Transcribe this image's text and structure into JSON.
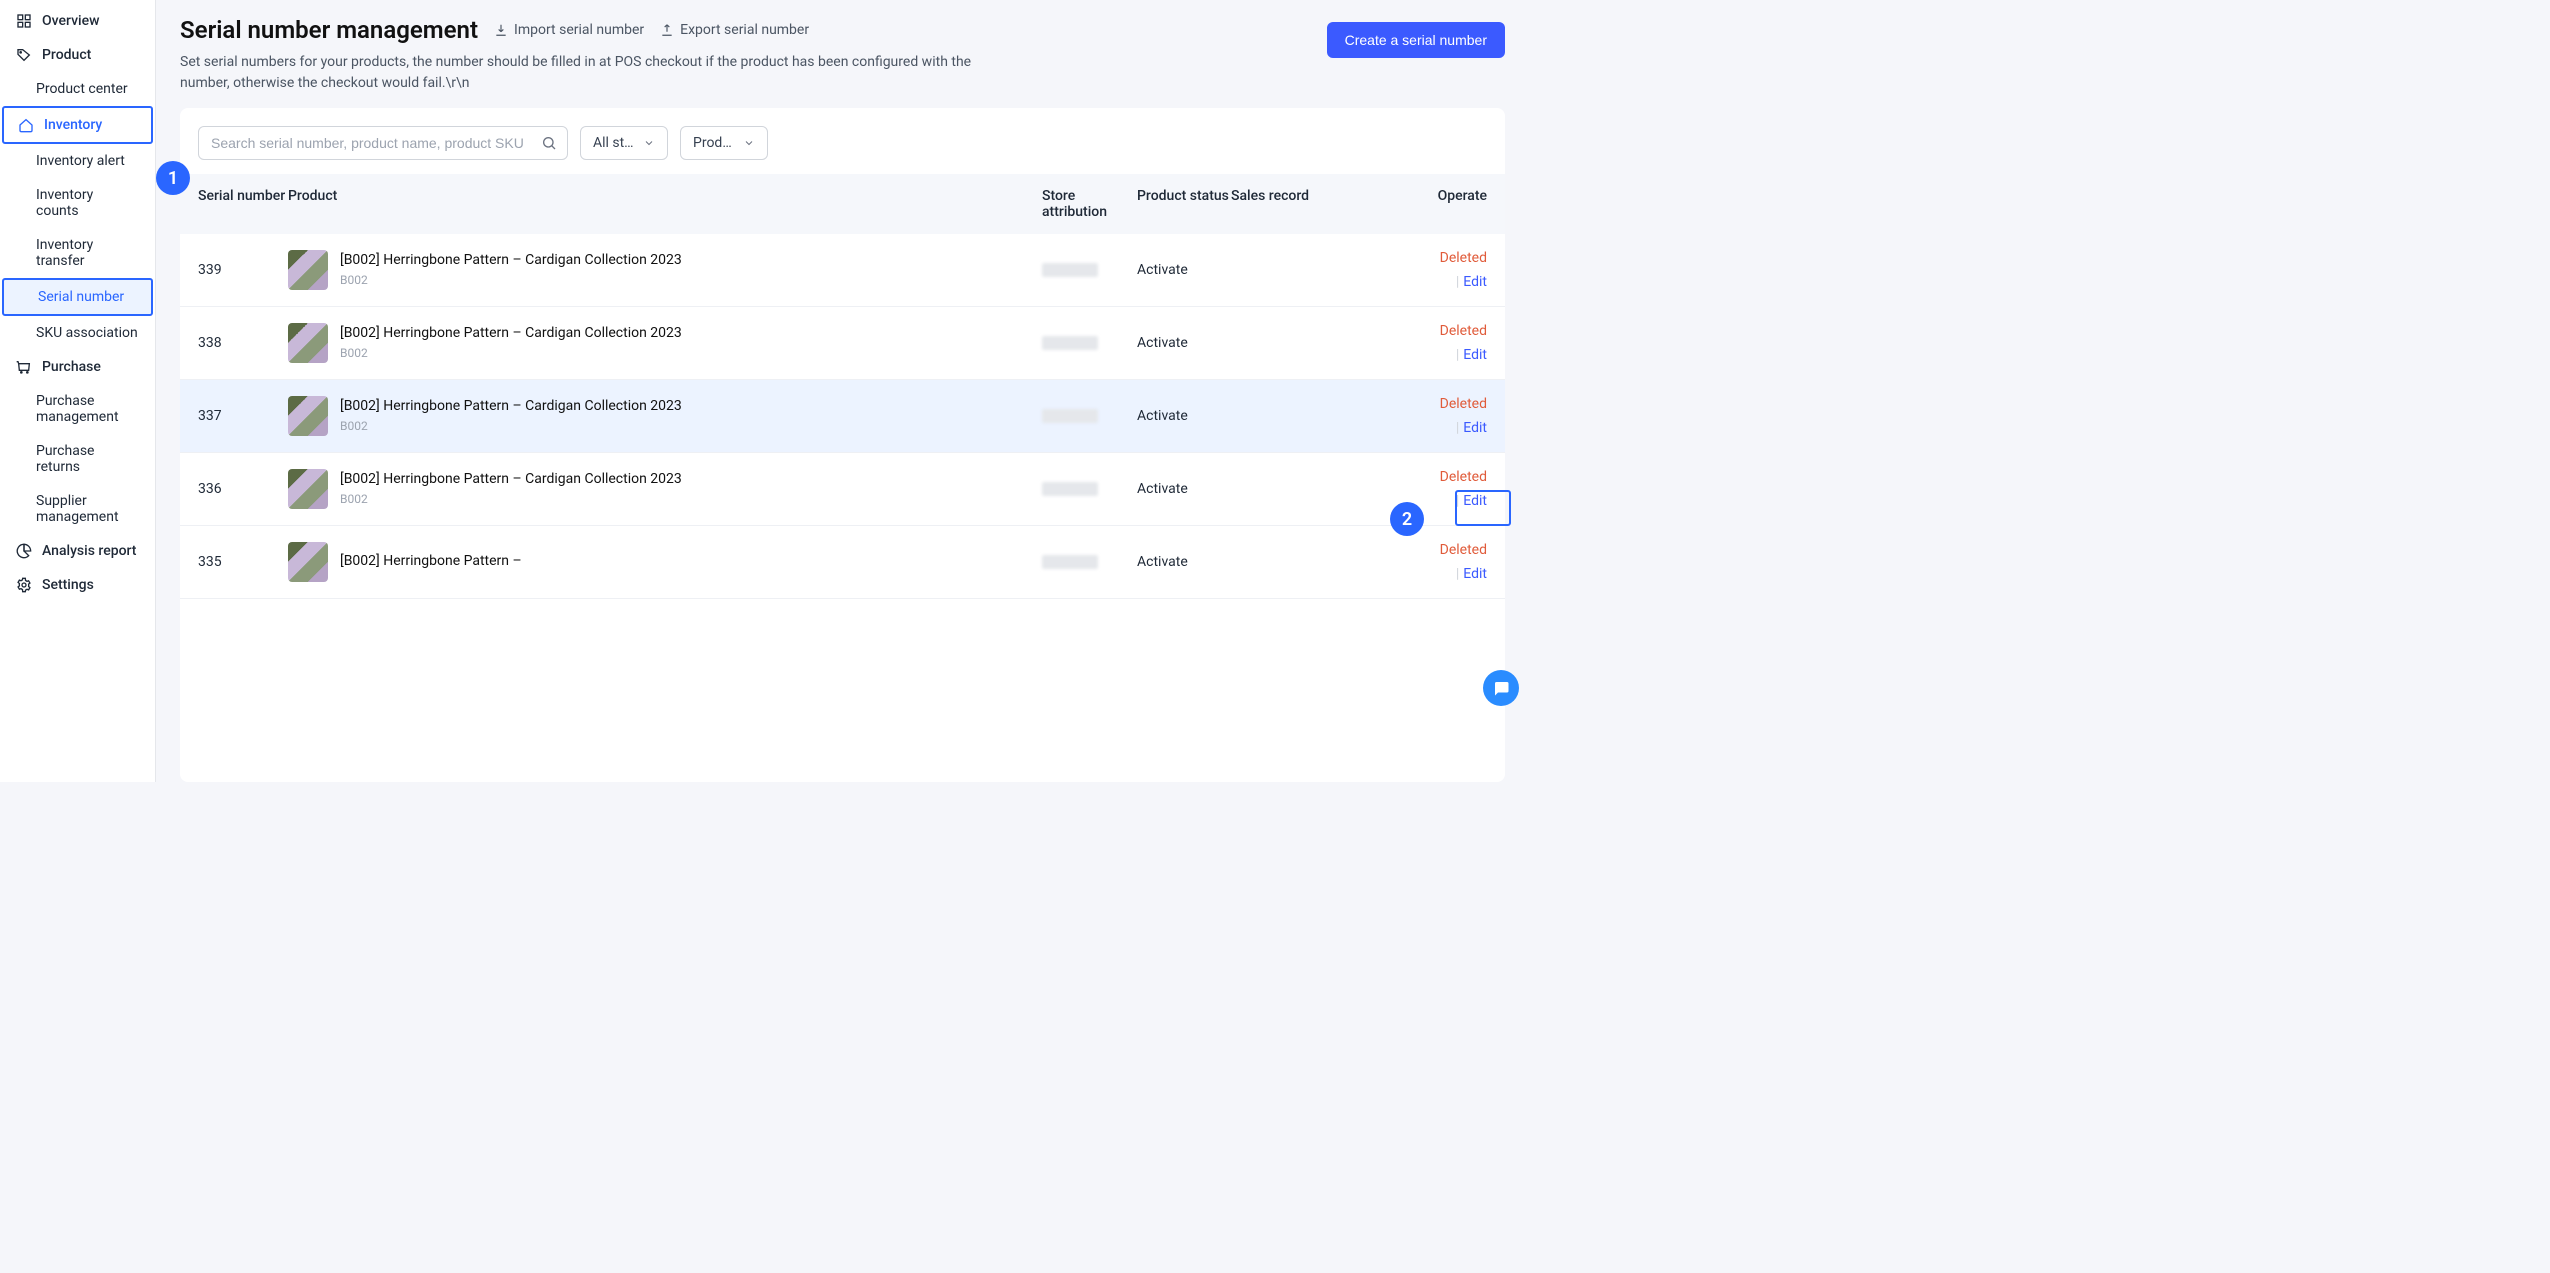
{
  "sidebar": {
    "overview": "Overview",
    "product": "Product",
    "product_center": "Product center",
    "inventory": "Inventory",
    "inventory_alert": "Inventory alert",
    "inventory_counts": "Inventory counts",
    "inventory_transfer": "Inventory transfer",
    "serial_number": "Serial number",
    "sku_association": "SKU association",
    "purchase": "Purchase",
    "purchase_management": "Purchase management",
    "purchase_returns": "Purchase returns",
    "supplier_management": "Supplier management",
    "analysis_report": "Analysis report",
    "settings": "Settings"
  },
  "header": {
    "title": "Serial number management",
    "import_label": "Import serial number",
    "export_label": "Export serial number",
    "create_button": "Create a serial number",
    "description": "Set serial numbers for your products, the number should be filled in at POS checkout if the product has been configured with the number, otherwise the checkout would fail.\\r\\n"
  },
  "filters": {
    "search_placeholder": "Search serial number, product name, product SKU",
    "stores_label": "All stores",
    "status_label": "Product s…"
  },
  "table": {
    "columns": {
      "serial": "Serial number",
      "product": "Product",
      "store": "Store attribution",
      "status": "Product status",
      "sales": "Sales record",
      "operate": "Operate"
    },
    "deleted_label": "Deleted",
    "edit_label": "Edit",
    "rows": [
      {
        "serial": "339",
        "product": "[B002] Herringbone Pattern – Cardigan Collection 2023",
        "sku": "B002",
        "status": "Activate"
      },
      {
        "serial": "338",
        "product": "[B002] Herringbone Pattern – Cardigan Collection 2023",
        "sku": "B002",
        "status": "Activate"
      },
      {
        "serial": "337",
        "product": "[B002] Herringbone Pattern – Cardigan Collection 2023",
        "sku": "B002",
        "status": "Activate",
        "hovered": true,
        "delete_highlighted": true
      },
      {
        "serial": "336",
        "product": "[B002] Herringbone Pattern – Cardigan Collection 2023",
        "sku": "B002",
        "status": "Activate"
      },
      {
        "serial": "335",
        "product": "[B002] Herringbone Pattern –",
        "sku": "",
        "status": "Activate"
      }
    ]
  },
  "annotations": {
    "badge1": "1",
    "badge2": "2"
  }
}
